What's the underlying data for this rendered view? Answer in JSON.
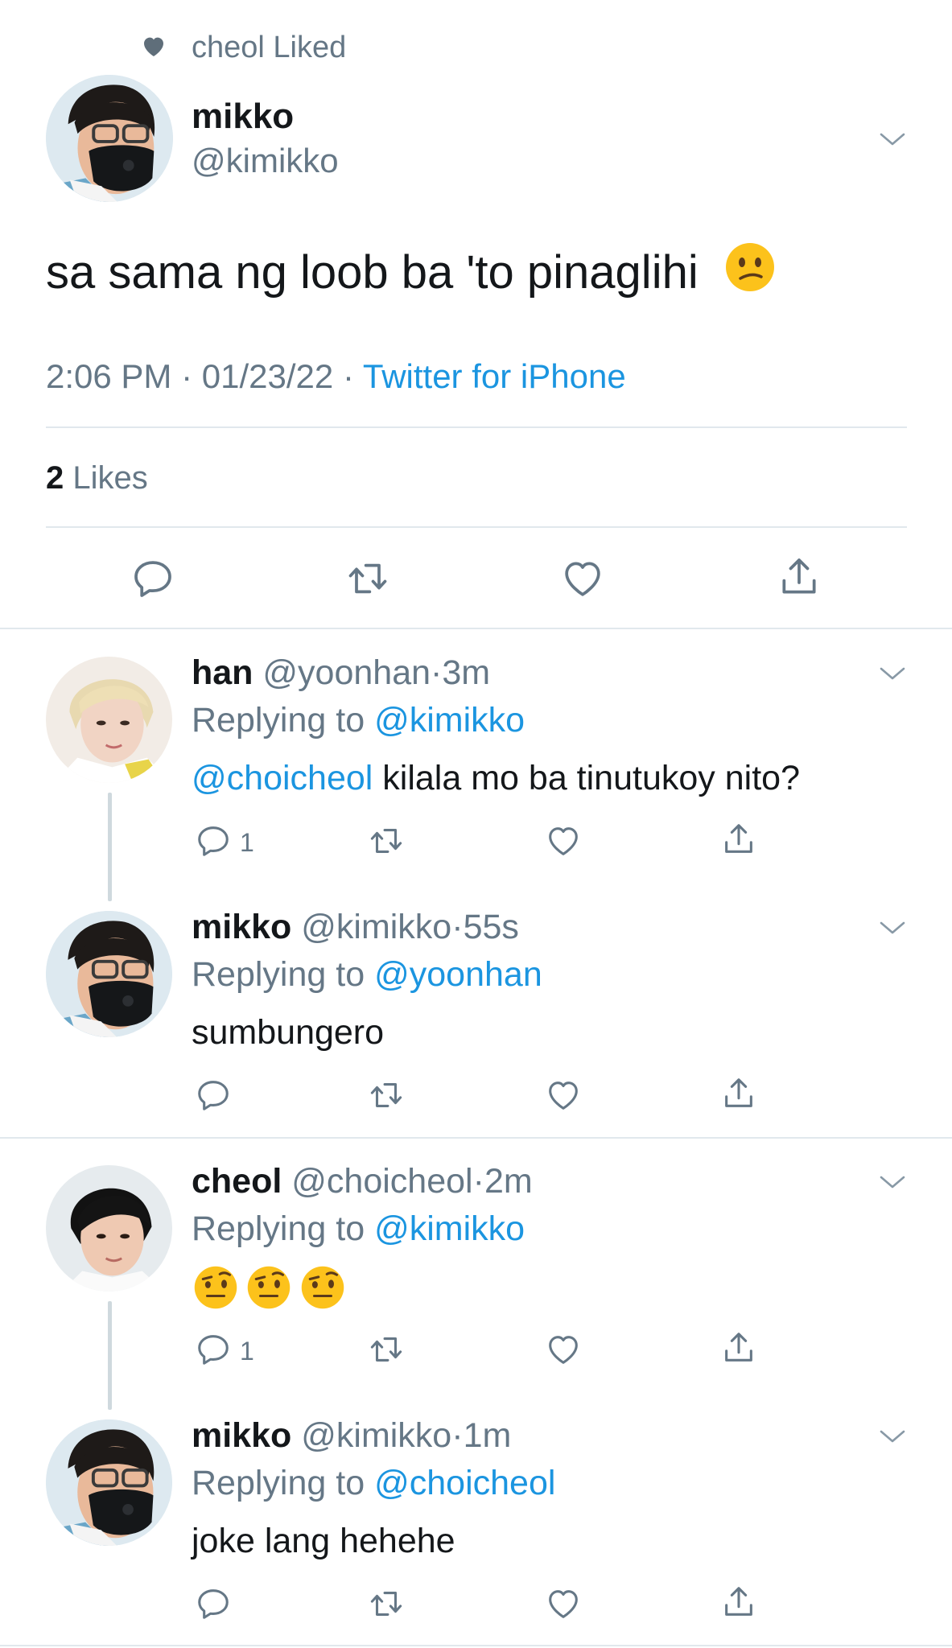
{
  "liked_banner": {
    "text": "cheol Liked",
    "icon": "heart-icon"
  },
  "main_tweet": {
    "display_name": "mikko",
    "handle": "@kimikko",
    "text": "sa sama ng loob ba 'to pinaglihi",
    "emoji": "confused-face",
    "time": "2:06 PM",
    "sep1": "·",
    "date": "01/23/22",
    "sep2": "·",
    "source": "Twitter for iPhone",
    "likes_count": "2",
    "likes_label": "Likes"
  },
  "actions": [
    "reply-icon",
    "retweet-icon",
    "like-icon",
    "share-icon"
  ],
  "replies": [
    {
      "display_name": "han",
      "handle": "@yoonhan",
      "sep": "·",
      "time": "3m",
      "replying_label": "Replying to",
      "replying_to": "@kimikko",
      "mention": "@choicheol",
      "text": " kilala mo ba tinutukoy nito?",
      "reply_count": "1"
    },
    {
      "display_name": "mikko",
      "handle": "@kimikko",
      "sep": "·",
      "time": "55s",
      "replying_label": "Replying to",
      "replying_to": "@yoonhan",
      "text": "sumbungero",
      "reply_count": ""
    },
    {
      "display_name": "cheol",
      "handle": "@choicheol",
      "sep": "·",
      "time": "2m",
      "replying_label": "Replying to",
      "replying_to": "@kimikko",
      "emoji": [
        "face-with-raised-eyebrow",
        "face-with-raised-eyebrow",
        "face-with-raised-eyebrow"
      ],
      "reply_count": "1"
    },
    {
      "display_name": "mikko",
      "handle": "@kimikko",
      "sep": "·",
      "time": "1m",
      "replying_label": "Replying to",
      "replying_to": "@choicheol",
      "text": "joke lang hehehe",
      "reply_count": ""
    }
  ],
  "colors": {
    "link": "#1b95e0",
    "secondary": "#657786",
    "divider": "#e1e8ed"
  }
}
